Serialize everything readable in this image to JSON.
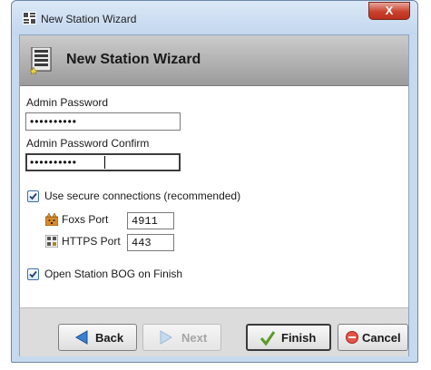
{
  "window": {
    "title": "New Station Wizard",
    "close_glyph": "X"
  },
  "header": {
    "title": "New Station Wizard",
    "icon": "station-icon"
  },
  "form": {
    "admin_password": {
      "label": "Admin Password",
      "value": "••••••••••"
    },
    "admin_password_confirm": {
      "label": "Admin Password Confirm",
      "value": "••••••••••"
    },
    "secure_connections": {
      "label": "Use secure connections (recommended)",
      "checked": true
    },
    "foxs_port": {
      "label": "Foxs Port",
      "value": "4911",
      "icon": "foxs-icon"
    },
    "https_port": {
      "label": "HTTPS Port",
      "value": "443",
      "icon": "https-icon"
    },
    "open_station_bog": {
      "label": "Open Station BOG on Finish",
      "checked": true
    }
  },
  "buttons": {
    "back": {
      "label": "Back",
      "enabled": true
    },
    "next": {
      "label": "Next",
      "enabled": false
    },
    "finish": {
      "label": "Finish",
      "enabled": true,
      "default": true
    },
    "cancel": {
      "label": "Cancel",
      "enabled": true
    }
  },
  "colors": {
    "window_frame": "#c6d9ee",
    "header_bg": "#b2b2b2",
    "close_button": "#c9412d",
    "checkbox_border": "#3d6fa8"
  }
}
